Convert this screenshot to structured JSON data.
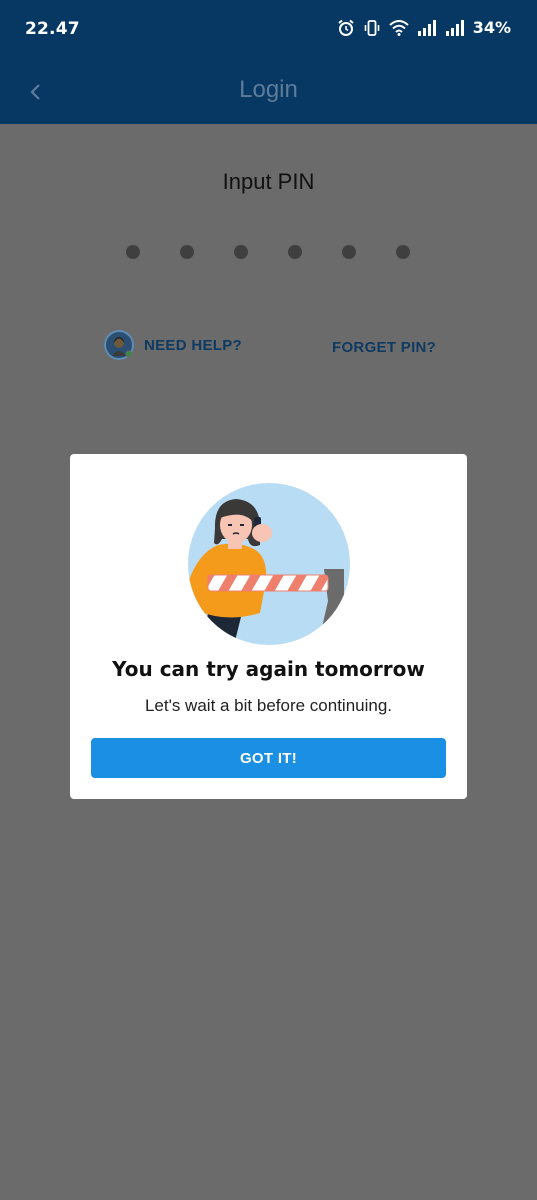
{
  "status_bar": {
    "time": "22.47",
    "battery": "34%",
    "icons": [
      "alarm-icon",
      "vibrate-icon",
      "wifi-icon",
      "signal-icon",
      "signal-icon"
    ]
  },
  "header": {
    "title": "Login",
    "back_icon": "chevron-left-icon"
  },
  "pin": {
    "title": "Input PIN",
    "length": 6
  },
  "links": {
    "need_help": "NEED HELP?",
    "forget_pin": "FORGET PIN?"
  },
  "dialog": {
    "title": "You can try again tomorrow",
    "message": "Let's wait a bit before continuing.",
    "button": "GOT IT!"
  },
  "colors": {
    "header_bg": "#073864",
    "title_muted": "#5d7c99",
    "overlay_bg": "#6b6b6b",
    "link": "#0f3a62",
    "primary_button": "#1a8fe3"
  }
}
